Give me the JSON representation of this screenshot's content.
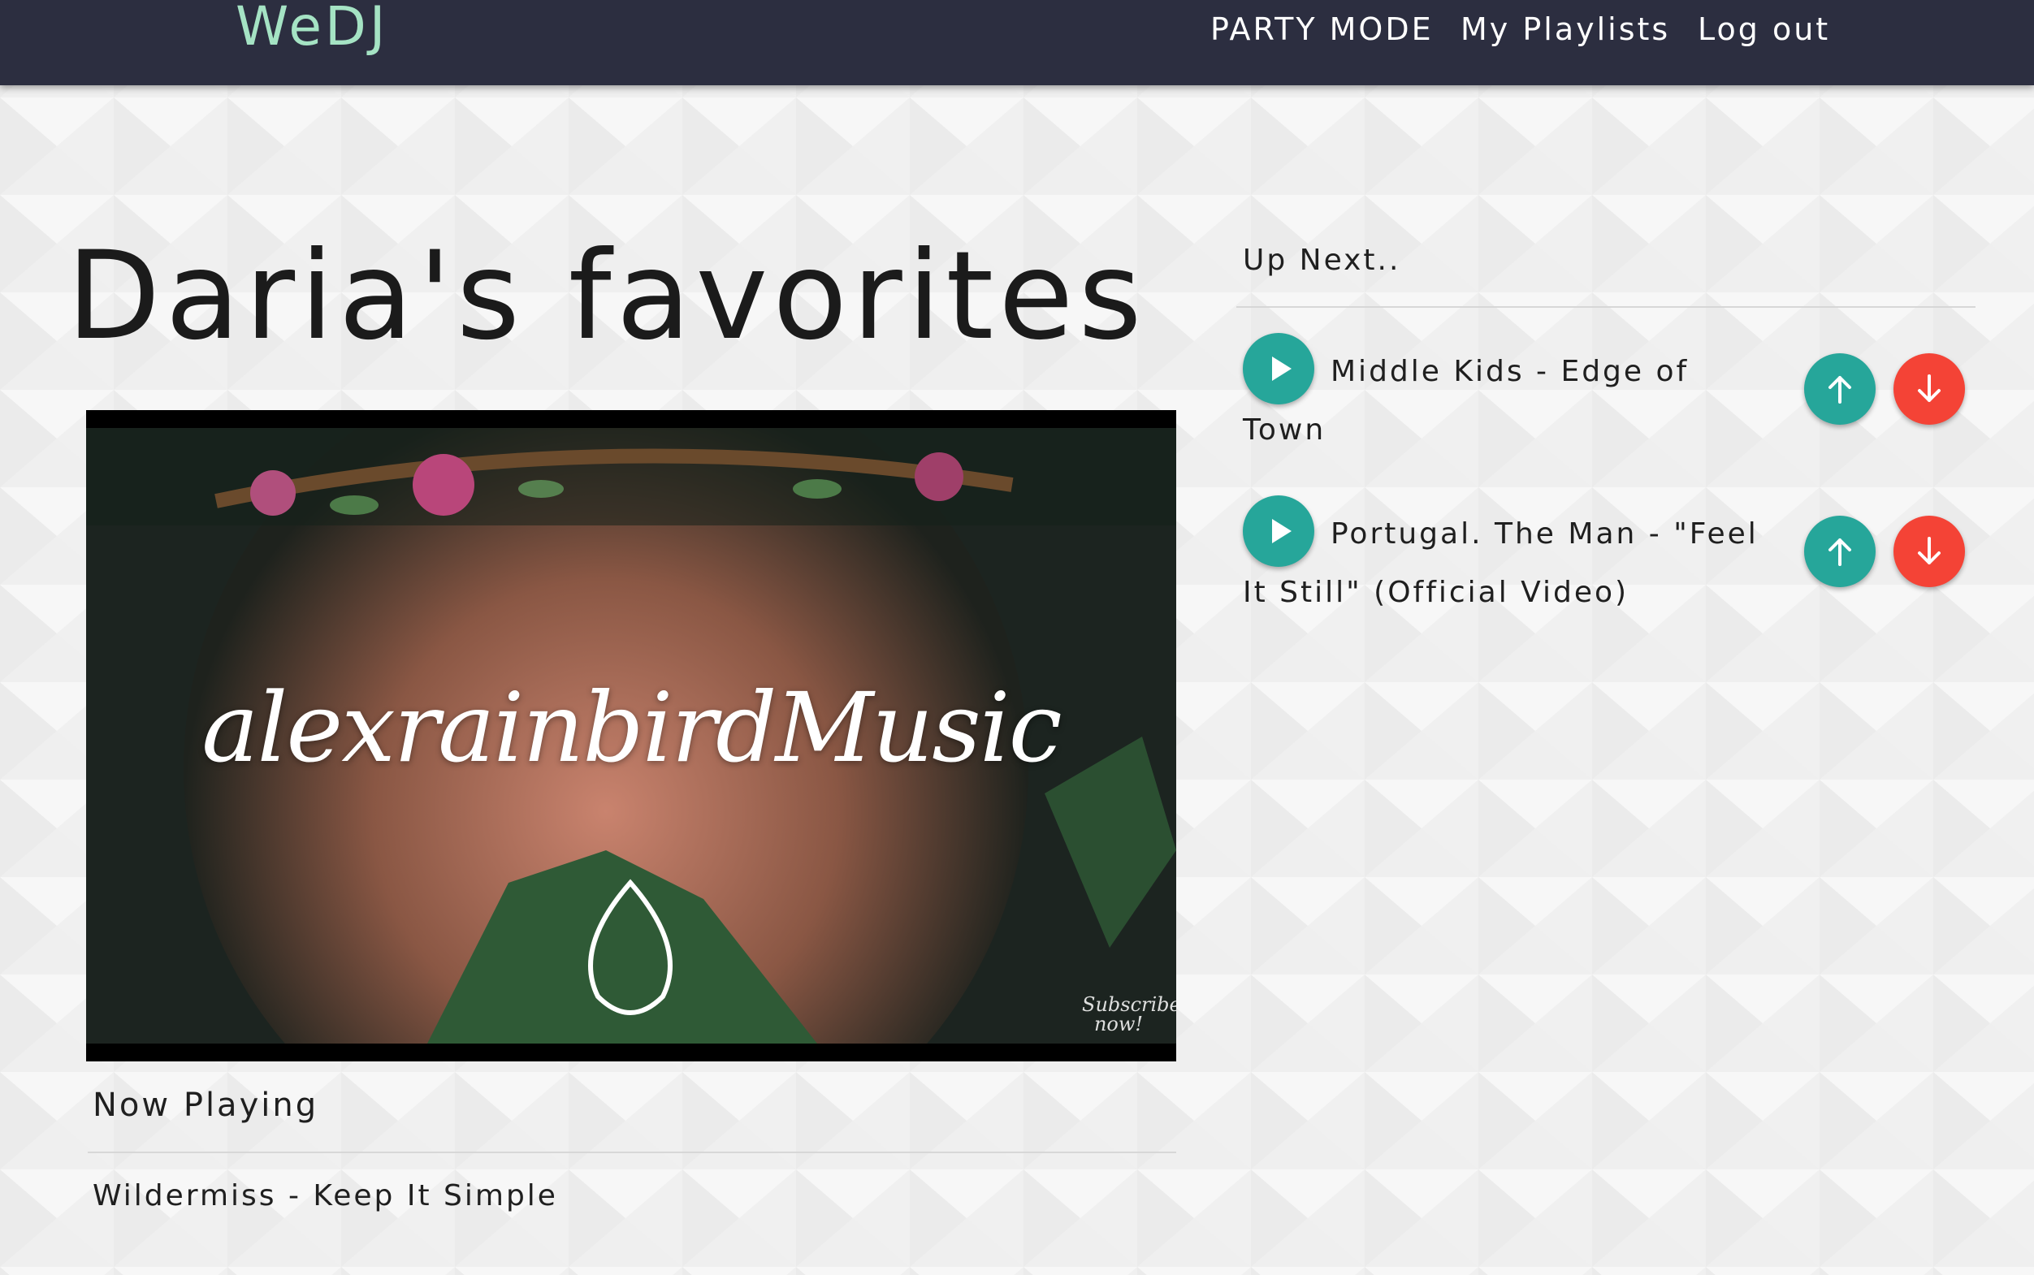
{
  "nav": {
    "brand": "WeDJ",
    "brand_color": "#a5e3c4",
    "background": "#2c2e40",
    "links": [
      "PARTY MODE",
      "My Playlists",
      "Log out"
    ]
  },
  "playlist": {
    "title": "Daria's favorites"
  },
  "video": {
    "watermark": "alexrainbirdMusic",
    "subscribe_text": "Subscribe now!"
  },
  "now_playing": {
    "label": "Now Playing",
    "track": "Wildermiss - Keep It Simple"
  },
  "up_next": {
    "label": "Up Next..",
    "items": [
      {
        "title": "Middle Kids - Edge of Town"
      },
      {
        "title": "Portugal. The Man - \"Feel It Still\" (Official Video)"
      }
    ]
  },
  "icons": {
    "play": "play-icon",
    "upvote": "arrow-up-icon",
    "downvote": "arrow-down-icon"
  },
  "colors": {
    "accent_teal": "#26a69a",
    "accent_red": "#f44336",
    "text": "#1f1f1f"
  }
}
